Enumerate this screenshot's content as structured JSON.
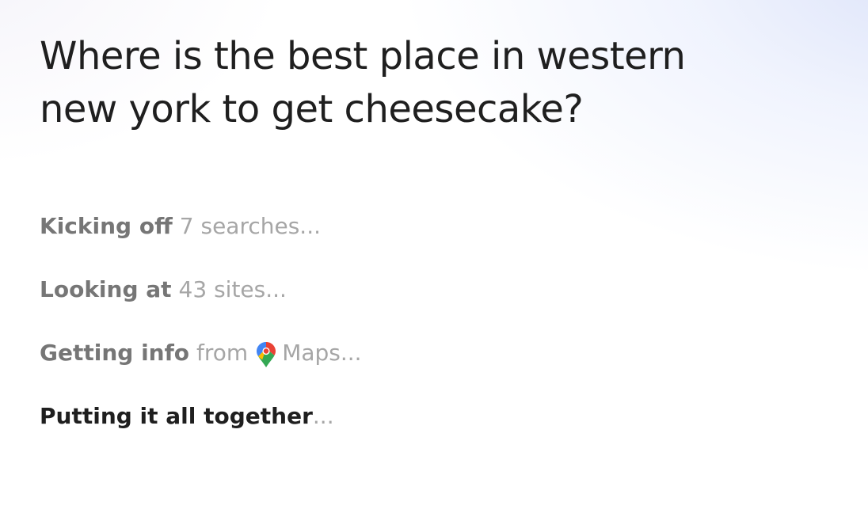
{
  "query": {
    "title": "Where is the best place in western new york to get cheesecake?"
  },
  "steps": [
    {
      "strong": "Kicking off",
      "light": "7 searches..."
    },
    {
      "strong": "Looking at",
      "light": "43 sites..."
    },
    {
      "strong": "Getting info",
      "from": "from",
      "source": "Maps...",
      "icon": "google-maps-pin-icon"
    },
    {
      "strong": "Putting it all together",
      "light": "..."
    }
  ],
  "colors": {
    "title": "#1f1f1f",
    "step_done": "#767676",
    "step_muted": "#a6a6a6",
    "step_active": "#1f1f1f"
  }
}
